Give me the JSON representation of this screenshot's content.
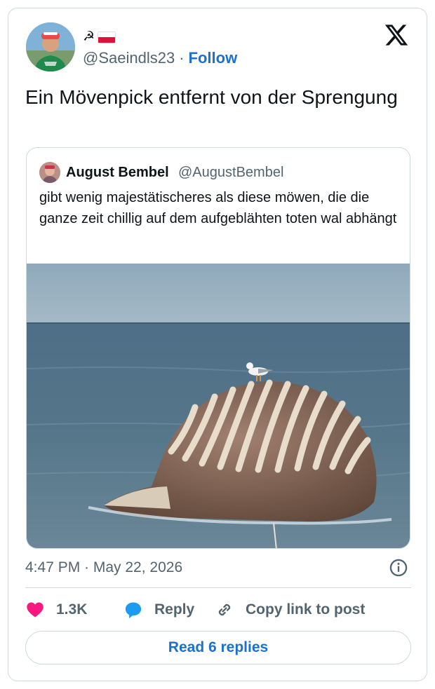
{
  "author": {
    "display_name_symbol": "☭",
    "flag_colors": [
      "#ffffff",
      "#dc143c"
    ],
    "handle": "@Saeindls23",
    "separator": "·",
    "follow_label": "Follow"
  },
  "tweet": {
    "text": "Ein Mövenpick entfernt von der Sprengung"
  },
  "quoted": {
    "name": "August Bembel",
    "handle": "@AugustBembel",
    "text": "gibt wenig majestätischeres als diese möwen, die die ganze zeit chillig auf dem aufgeblähten toten wal abhängt"
  },
  "meta": {
    "timestamp": "4:47 PM · May 22, 2026"
  },
  "actions": {
    "likes": "1.3K",
    "reply_label": "Reply",
    "copy_label": "Copy link to post"
  },
  "read_replies_label": "Read 6 replies",
  "colors": {
    "accent": "#1d6fd1",
    "like": "#f91880",
    "reply_icon": "#1d9bf0",
    "muted": "#536471",
    "border": "#cfd9de"
  }
}
